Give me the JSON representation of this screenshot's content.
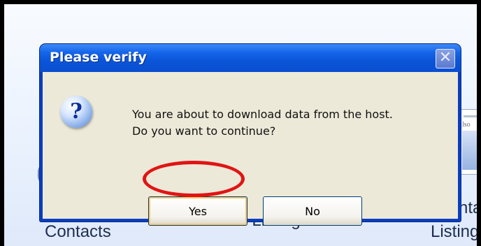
{
  "background": {
    "labels": {
      "contacts": "Contacts",
      "add_listings": "Add Listings",
      "partial_right_top": "nta",
      "partial_right_bottom": "Listing"
    },
    "thumbnail_text": "lso"
  },
  "dialog": {
    "title": "Please verify",
    "close_glyph": "✕",
    "icon": "question-icon",
    "icon_glyph": "?",
    "message_line1": "You are about to download data from the host.",
    "message_line2": "Do you want to continue?",
    "yes_label": "Yes",
    "no_label": "No"
  },
  "annotation": {
    "highlight_color": "#e11414",
    "highlight_target": "yes-button"
  },
  "colors": {
    "titlebar": "#0b55d8",
    "client": "#ece9d8"
  }
}
